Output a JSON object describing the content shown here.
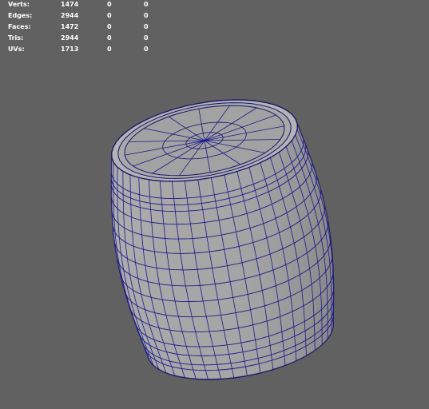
{
  "viewport": {
    "background": "#616161",
    "wire_color": "#1c1a8a",
    "object": "barrel-mesh"
  },
  "hud": {
    "rows": [
      {
        "label": "Verts:",
        "values": [
          "1474",
          "0",
          "0"
        ]
      },
      {
        "label": "Edges:",
        "values": [
          "2944",
          "0",
          "0"
        ]
      },
      {
        "label": "Faces:",
        "values": [
          "1472",
          "0",
          "0"
        ]
      },
      {
        "label": "Tris:",
        "values": [
          "2944",
          "0",
          "0"
        ]
      },
      {
        "label": "UVs:",
        "values": [
          "1713",
          "0",
          "0"
        ]
      }
    ]
  }
}
